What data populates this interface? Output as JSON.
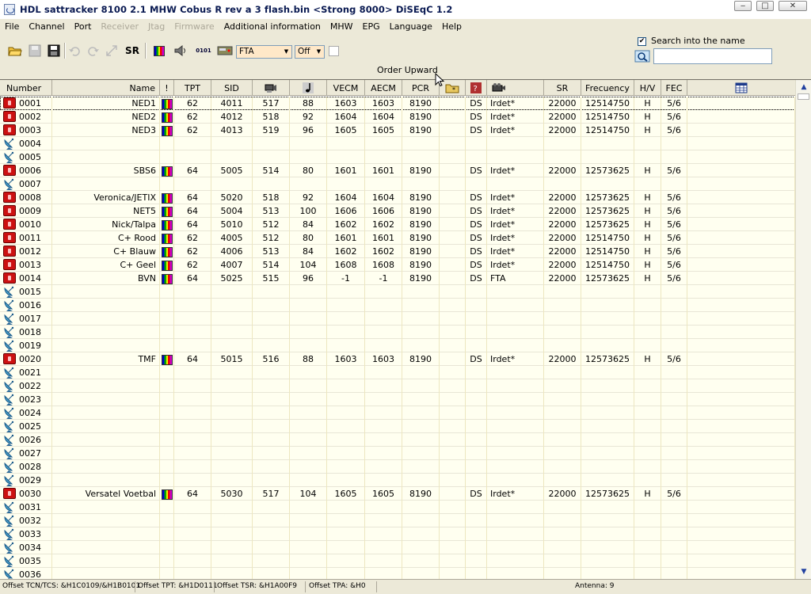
{
  "window": {
    "title": "HDL sattracker  8100 2.1 MHW Cobus R rev a 3 flash.bin  <Strong 8000>  DiSEqC 1.2",
    "minimize": "‒",
    "maximize": "□",
    "close": "✕"
  },
  "menu": [
    {
      "label": "File",
      "enabled": true
    },
    {
      "label": "Channel",
      "enabled": true
    },
    {
      "label": "Port",
      "enabled": true
    },
    {
      "label": "Receiver",
      "enabled": false
    },
    {
      "label": "Jtag",
      "enabled": false
    },
    {
      "label": "Firmware",
      "enabled": false
    },
    {
      "label": "Additional information",
      "enabled": true
    },
    {
      "label": "MHW",
      "enabled": true
    },
    {
      "label": "EPG",
      "enabled": true
    },
    {
      "label": "Language",
      "enabled": true
    },
    {
      "label": "Help",
      "enabled": true
    }
  ],
  "toolbar": {
    "sr_label": "SR",
    "hex_label": "0101",
    "fta_value": "FTA",
    "off_value": "Off"
  },
  "search": {
    "checked": true,
    "label": "Search into the name",
    "value": ""
  },
  "order_label": "Order Upward",
  "columns": {
    "number": "Number",
    "name": "Name",
    "excl": "!",
    "tpt": "TPT",
    "sid": "SID",
    "vecm": "VECM",
    "aecm": "AECM",
    "pcr": "PCR",
    "sr": "SR",
    "frequency": "Frecuency",
    "hv": "H/V",
    "fec": "FEC"
  },
  "rows": [
    {
      "num": "0001",
      "type": "tv",
      "name": "NED1",
      "tpt": "62",
      "sid": "4011",
      "v": "517",
      "a": "88",
      "vecm": "1603",
      "aecm": "1603",
      "pcr": "8190",
      "ds": "DS",
      "ca": "Irdet*",
      "sr": "22000",
      "freq": "12514750",
      "hv": "H",
      "fec": "5/6"
    },
    {
      "num": "0002",
      "type": "tv",
      "name": "NED2",
      "tpt": "62",
      "sid": "4012",
      "v": "518",
      "a": "92",
      "vecm": "1604",
      "aecm": "1604",
      "pcr": "8190",
      "ds": "DS",
      "ca": "Irdet*",
      "sr": "22000",
      "freq": "12514750",
      "hv": "H",
      "fec": "5/6"
    },
    {
      "num": "0003",
      "type": "tv",
      "name": "NED3",
      "tpt": "62",
      "sid": "4013",
      "v": "519",
      "a": "96",
      "vecm": "1605",
      "aecm": "1605",
      "pcr": "8190",
      "ds": "DS",
      "ca": "Irdet*",
      "sr": "22000",
      "freq": "12514750",
      "hv": "H",
      "fec": "5/6"
    },
    {
      "num": "0004",
      "type": "empty"
    },
    {
      "num": "0005",
      "type": "empty"
    },
    {
      "num": "0006",
      "type": "tv",
      "name": "SBS6",
      "tpt": "64",
      "sid": "5005",
      "v": "514",
      "a": "80",
      "vecm": "1601",
      "aecm": "1601",
      "pcr": "8190",
      "ds": "DS",
      "ca": "Irdet*",
      "sr": "22000",
      "freq": "12573625",
      "hv": "H",
      "fec": "5/6"
    },
    {
      "num": "0007",
      "type": "empty"
    },
    {
      "num": "0008",
      "type": "tv",
      "name": "Veronica/JETIX",
      "tpt": "64",
      "sid": "5020",
      "v": "518",
      "a": "92",
      "vecm": "1604",
      "aecm": "1604",
      "pcr": "8190",
      "ds": "DS",
      "ca": "Irdet*",
      "sr": "22000",
      "freq": "12573625",
      "hv": "H",
      "fec": "5/6"
    },
    {
      "num": "0009",
      "type": "tv",
      "name": "NET5",
      "tpt": "64",
      "sid": "5004",
      "v": "513",
      "a": "100",
      "vecm": "1606",
      "aecm": "1606",
      "pcr": "8190",
      "ds": "DS",
      "ca": "Irdet*",
      "sr": "22000",
      "freq": "12573625",
      "hv": "H",
      "fec": "5/6"
    },
    {
      "num": "0010",
      "type": "tv",
      "name": "Nick/Talpa",
      "tpt": "64",
      "sid": "5010",
      "v": "512",
      "a": "84",
      "vecm": "1602",
      "aecm": "1602",
      "pcr": "8190",
      "ds": "DS",
      "ca": "Irdet*",
      "sr": "22000",
      "freq": "12573625",
      "hv": "H",
      "fec": "5/6"
    },
    {
      "num": "0011",
      "type": "tv",
      "name": "C+ Rood",
      "tpt": "62",
      "sid": "4005",
      "v": "512",
      "a": "80",
      "vecm": "1601",
      "aecm": "1601",
      "pcr": "8190",
      "ds": "DS",
      "ca": "Irdet*",
      "sr": "22000",
      "freq": "12514750",
      "hv": "H",
      "fec": "5/6"
    },
    {
      "num": "0012",
      "type": "tv",
      "name": "C+ Blauw",
      "tpt": "62",
      "sid": "4006",
      "v": "513",
      "a": "84",
      "vecm": "1602",
      "aecm": "1602",
      "pcr": "8190",
      "ds": "DS",
      "ca": "Irdet*",
      "sr": "22000",
      "freq": "12514750",
      "hv": "H",
      "fec": "5/6"
    },
    {
      "num": "0013",
      "type": "tv",
      "name": "C+ Geel",
      "tpt": "62",
      "sid": "4007",
      "v": "514",
      "a": "104",
      "vecm": "1608",
      "aecm": "1608",
      "pcr": "8190",
      "ds": "DS",
      "ca": "Irdet*",
      "sr": "22000",
      "freq": "12514750",
      "hv": "H",
      "fec": "5/6"
    },
    {
      "num": "0014",
      "type": "tv",
      "name": "BVN",
      "tpt": "64",
      "sid": "5025",
      "v": "515",
      "a": "96",
      "vecm": "-1",
      "aecm": "-1",
      "pcr": "8190",
      "ds": "DS",
      "ca": "FTA",
      "sr": "22000",
      "freq": "12573625",
      "hv": "H",
      "fec": "5/6"
    },
    {
      "num": "0015",
      "type": "empty"
    },
    {
      "num": "0016",
      "type": "empty"
    },
    {
      "num": "0017",
      "type": "empty"
    },
    {
      "num": "0018",
      "type": "empty"
    },
    {
      "num": "0019",
      "type": "empty"
    },
    {
      "num": "0020",
      "type": "tv",
      "name": "TMF",
      "tpt": "64",
      "sid": "5015",
      "v": "516",
      "a": "88",
      "vecm": "1603",
      "aecm": "1603",
      "pcr": "8190",
      "ds": "DS",
      "ca": "Irdet*",
      "sr": "22000",
      "freq": "12573625",
      "hv": "H",
      "fec": "5/6"
    },
    {
      "num": "0021",
      "type": "empty"
    },
    {
      "num": "0022",
      "type": "empty"
    },
    {
      "num": "0023",
      "type": "empty"
    },
    {
      "num": "0024",
      "type": "empty"
    },
    {
      "num": "0025",
      "type": "empty"
    },
    {
      "num": "0026",
      "type": "empty"
    },
    {
      "num": "0027",
      "type": "empty"
    },
    {
      "num": "0028",
      "type": "empty"
    },
    {
      "num": "0029",
      "type": "empty"
    },
    {
      "num": "0030",
      "type": "tv",
      "name": "Versatel Voetbal",
      "tpt": "64",
      "sid": "5030",
      "v": "517",
      "a": "104",
      "vecm": "1605",
      "aecm": "1605",
      "pcr": "8190",
      "ds": "DS",
      "ca": "Irdet*",
      "sr": "22000",
      "freq": "12573625",
      "hv": "H",
      "fec": "5/6"
    },
    {
      "num": "0031",
      "type": "empty"
    },
    {
      "num": "0032",
      "type": "empty"
    },
    {
      "num": "0033",
      "type": "empty"
    },
    {
      "num": "0034",
      "type": "empty"
    },
    {
      "num": "0035",
      "type": "empty"
    },
    {
      "num": "0036",
      "type": "empty"
    }
  ],
  "status": {
    "offset_tcn": "Offset TCN/TCS: &H1C0109/&H1B0101",
    "offset_tpt": "Offset TPT: &H1D0111",
    "offset_tsr": "Offset TSR: &H1A00F9",
    "offset_tpa": "Offset TPA: &H0",
    "antenna": "Antenna: 9"
  },
  "colors": {
    "row_bg": "#fffff0",
    "tv_icon": "#cc1111",
    "chrome": "#ece9d8"
  }
}
